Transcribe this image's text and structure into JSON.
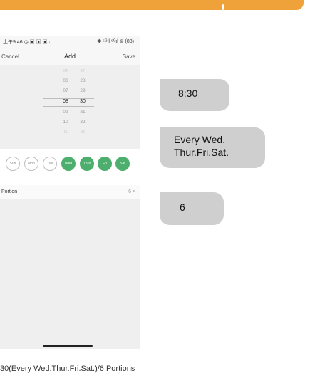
{
  "status_bar": {
    "time": "上午9:46 ◷ ▣ ▣ ▣ ·",
    "right": "✱ ⁵ᴳıl ⁵ᴳıl ⊛ (88)"
  },
  "navbar": {
    "cancel": "Cancel",
    "title": "Add",
    "save": "Save"
  },
  "picker": {
    "hours": [
      "04",
      "06",
      "07",
      "08",
      "09",
      "10",
      "11"
    ],
    "minutes": [
      "27",
      "28",
      "29",
      "30",
      "31",
      "32",
      "33"
    ],
    "selected_hour": "08",
    "selected_minute": "30"
  },
  "days": [
    {
      "label": "Sun",
      "active": false
    },
    {
      "label": "Mon",
      "active": false
    },
    {
      "label": "Tue",
      "active": false
    },
    {
      "label": "Wed",
      "active": true
    },
    {
      "label": "Thur",
      "active": true
    },
    {
      "label": "Fri",
      "active": true
    },
    {
      "label": "Sat",
      "active": true
    }
  ],
  "portion": {
    "label": "Portion",
    "value": "6 >"
  },
  "bubbles": {
    "time": "8:30",
    "days_line1": "Every Wed.",
    "days_line2": "Thur.Fri.Sat.",
    "portion": "6"
  },
  "caption": "30(Every Wed.Thur.Fri.Sat.)/6 Portions",
  "colors": {
    "active_day": "#4caf6e",
    "banner": "#f0a23a",
    "bubble": "#cfcfcf"
  }
}
